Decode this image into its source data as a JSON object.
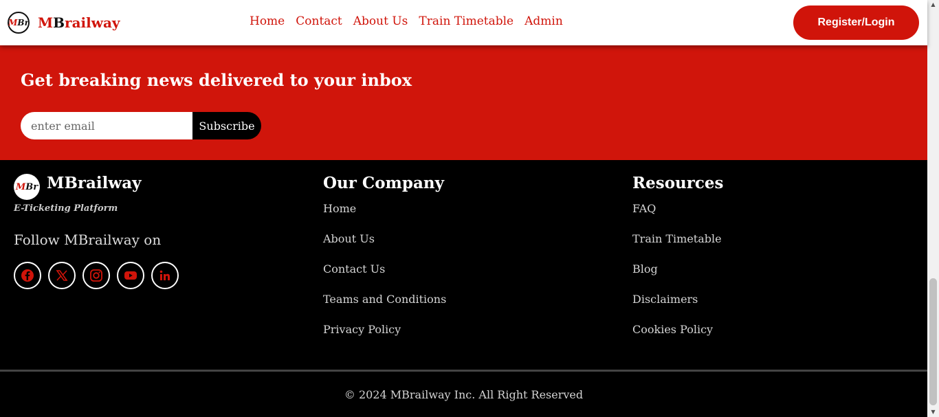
{
  "header": {
    "logo_m": "M",
    "logo_br": "Br",
    "brand_m": "M",
    "brand_b": "B",
    "brand_rest": "railway",
    "nav": [
      "Home",
      "Contact",
      "About Us",
      "Train Timetable",
      "Admin"
    ],
    "login_label": "Register/Login"
  },
  "newsletter": {
    "title": "Get breaking news delivered to your inbox",
    "email_placeholder": "enter email",
    "subscribe_label": "Subscribe"
  },
  "footer": {
    "brand": "MBrailway",
    "tagline": "E-Ticketing Platform",
    "follow": "Follow MBrailway on",
    "socials": [
      "facebook-icon",
      "x-icon",
      "instagram-icon",
      "youtube-icon",
      "linkedin-icon"
    ],
    "company": {
      "title": "Our Company",
      "links": [
        "Home",
        "About Us",
        "Contact Us",
        "Teams and Conditions",
        "Privacy Policy"
      ]
    },
    "resources": {
      "title": "Resources",
      "links": [
        "FAQ",
        "Train Timetable",
        "Blog",
        "Disclaimers",
        "Cookies Policy"
      ]
    },
    "copyright": "© 2024 MBrailway Inc. All Right Reserved"
  },
  "colors": {
    "accent": "#d0140a",
    "footer_bg": "#000000"
  }
}
